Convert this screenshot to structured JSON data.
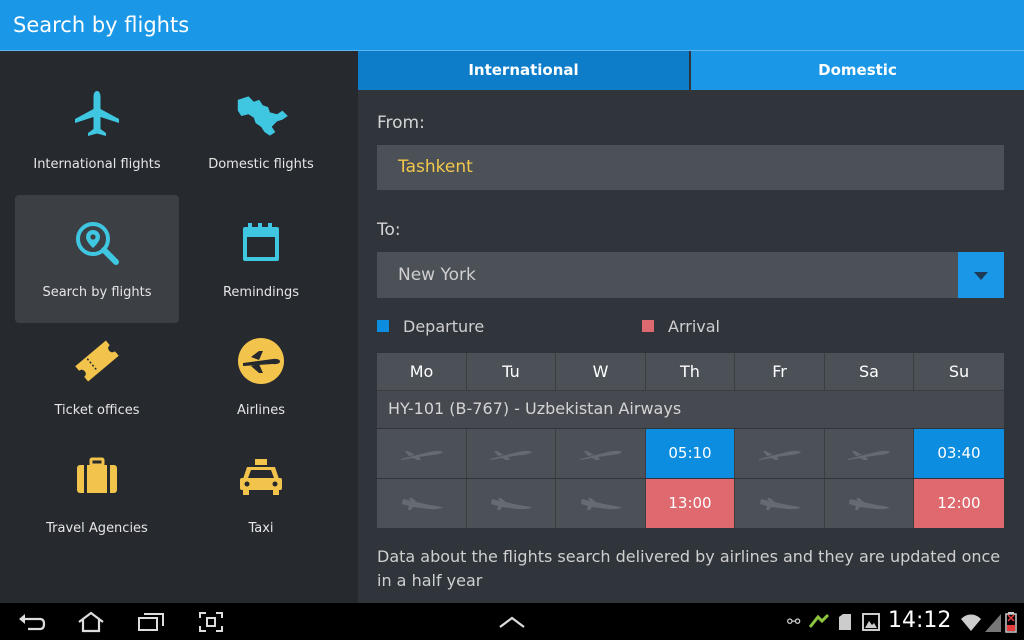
{
  "header": {
    "title": "Search by flights"
  },
  "sidebar": {
    "items": [
      {
        "label": "International flights",
        "icon": "airplane-icon"
      },
      {
        "label": "Domestic flights",
        "icon": "uzbekistan-map-icon"
      },
      {
        "label": "Search by flights",
        "icon": "search-location-icon",
        "selected": true
      },
      {
        "label": "Remindings",
        "icon": "calendar-icon"
      },
      {
        "label": "Ticket offices",
        "icon": "ticket-icon"
      },
      {
        "label": "Airlines",
        "icon": "airline-logo-icon"
      },
      {
        "label": "Travel Agencies",
        "icon": "suitcase-icon"
      },
      {
        "label": "Taxi",
        "icon": "taxi-icon"
      }
    ]
  },
  "tabs": [
    {
      "label": "International",
      "active": true
    },
    {
      "label": "Domestic",
      "active": false
    }
  ],
  "form": {
    "from_label": "From:",
    "from_value": "Tashkent",
    "to_label": "To:",
    "to_value": "New York"
  },
  "legend": {
    "departure": "Departure",
    "arrival": "Arrival",
    "departure_color": "#0d8de0",
    "arrival_color": "#de6a6f"
  },
  "schedule": {
    "days": [
      "Mo",
      "Tu",
      "W",
      "Th",
      "Fr",
      "Sa",
      "Su"
    ],
    "route": "HY-101 (B-767)  -  Uzbekistan Airways",
    "departures": [
      "",
      "",
      "",
      "05:10",
      "",
      "",
      "03:40"
    ],
    "arrivals": [
      "",
      "",
      "",
      "13:00",
      "",
      "",
      "12:00"
    ]
  },
  "note": "Data about the flights search delivered by airlines and they are updated once in a half year",
  "statusbar": {
    "time": "14:12"
  },
  "colors": {
    "accent": "#1a97e6",
    "icon_teal": "#3fc6e0",
    "icon_yellow": "#f2c44c"
  }
}
